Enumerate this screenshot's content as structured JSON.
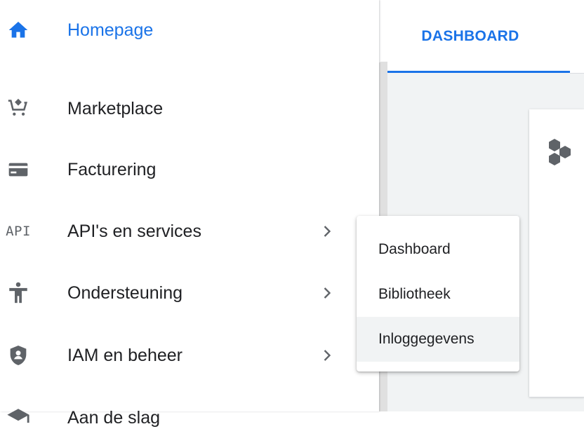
{
  "tabs": {
    "dashboard": "DASHBOARD"
  },
  "nav": {
    "items": [
      {
        "label": "Homepage",
        "icon": "home-icon",
        "active": true
      },
      {
        "label": "Marketplace",
        "icon": "cart-icon"
      },
      {
        "label": "Facturering",
        "icon": "billing-card-icon"
      },
      {
        "label": "API's en services",
        "icon": "api-icon",
        "icon_text": "API",
        "has_submenu": true
      },
      {
        "label": "Ondersteuning",
        "icon": "person-support-icon",
        "has_submenu": true
      },
      {
        "label": "IAM en beheer",
        "icon": "shield-icon",
        "has_submenu": true
      },
      {
        "label": "Aan de slag",
        "icon": "school-icon"
      }
    ]
  },
  "submenu": {
    "items": [
      {
        "label": "Dashboard"
      },
      {
        "label": "Bibliotheek"
      },
      {
        "label": "Inloggegevens",
        "hovered": true
      }
    ]
  },
  "card": {
    "icon": "hexagons-icon"
  },
  "colors": {
    "accent": "#1a73e8",
    "icon_gray": "#5f6368",
    "hover_bg": "#f1f3f4"
  }
}
